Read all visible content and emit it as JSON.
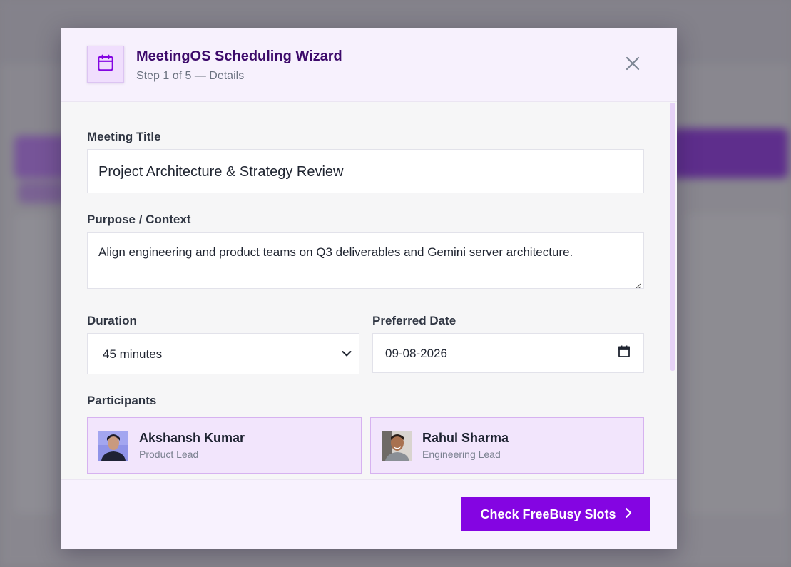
{
  "wizard": {
    "title": "MeetingOS Scheduling Wizard",
    "step": "Step 1 of 5 — Details",
    "icon": "calendar-icon"
  },
  "form": {
    "meeting_title_label": "Meeting Title",
    "meeting_title_value": "Project Architecture & Strategy Review",
    "purpose_label": "Purpose / Context",
    "purpose_value": "Align engineering and product teams on Q3 deliverables and Gemini server architecture.",
    "duration_label": "Duration",
    "duration_value": "45 minutes",
    "date_label": "Preferred Date",
    "date_value": "09-08-2026",
    "participants_label": "Participants"
  },
  "participants": [
    {
      "name": "Akshansh Kumar",
      "role": "Product Lead"
    },
    {
      "name": "Rahul Sharma",
      "role": "Engineering Lead"
    }
  ],
  "footer": {
    "primary_button_label": "Check FreeBusy Slots",
    "primary_button_icon": "chevron-right-icon"
  },
  "colors": {
    "accent": "#8405e2",
    "title": "#3d0a6b",
    "card_bg": "#f2e5fc",
    "card_border": "#d6b2f0"
  }
}
